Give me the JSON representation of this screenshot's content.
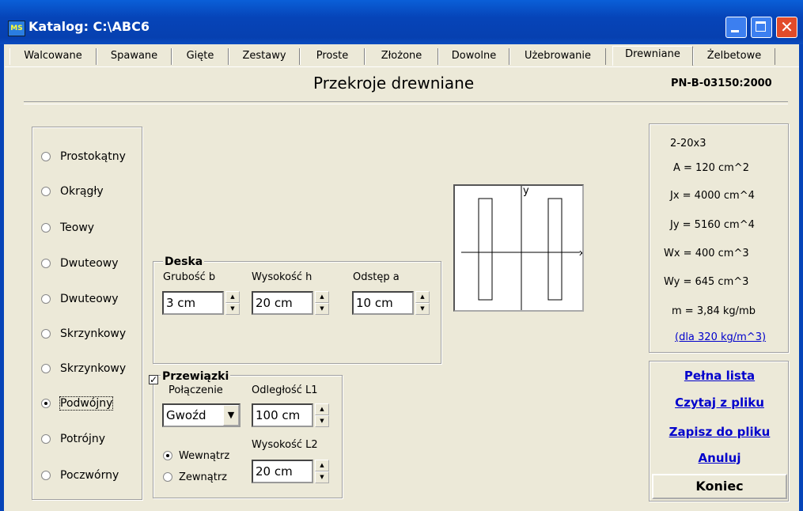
{
  "window": {
    "title": "Katalog: C:\\ABC6",
    "icon_text": "MS"
  },
  "tabs": [
    {
      "label": "Walcowane"
    },
    {
      "label": "Spawane"
    },
    {
      "label": "Gięte"
    },
    {
      "label": "Zestawy"
    },
    {
      "label": "Proste"
    },
    {
      "label": "Złożone"
    },
    {
      "label": "Dowolne"
    },
    {
      "label": "Użebrowanie"
    },
    {
      "label": "Drewniane",
      "active": true
    },
    {
      "label": "Żelbetowe"
    }
  ],
  "header": {
    "title": "Przekroje drewniane",
    "norm": "PN-B-03150:2000"
  },
  "section_types": [
    {
      "label": "Prostokątny",
      "selected": false
    },
    {
      "label": "Okrągły",
      "selected": false
    },
    {
      "label": "Teowy",
      "selected": false
    },
    {
      "label": "Dwuteowy",
      "selected": false
    },
    {
      "label": "Dwuteowy",
      "selected": false
    },
    {
      "label": "Skrzynkowy",
      "selected": false
    },
    {
      "label": "Skrzynkowy",
      "selected": false
    },
    {
      "label": "Podwójny",
      "selected": true
    },
    {
      "label": "Potrójny",
      "selected": false
    },
    {
      "label": "Poczwórny",
      "selected": false
    }
  ],
  "deska": {
    "title": "Deska",
    "grubosc_label": "Grubość b",
    "grubosc_value": "3 cm",
    "wysokosc_label": "Wysokość h",
    "wysokosc_value": "20 cm",
    "odstep_label": "Odstęp a",
    "odstep_value": "10 cm"
  },
  "przewiazki": {
    "title": "Przewiązki",
    "checked": true,
    "check_mark": "✓",
    "polaczenie_label": "Połączenie",
    "polaczenie_value": "Gwoźd",
    "odleglosc_label": "Odległość L1",
    "odleglosc_value": "100 cm",
    "wysokosc_label": "Wysokość L2",
    "wysokosc_value": "20 cm",
    "wewnatrz_label": "Wewnątrz",
    "zewnatrz_label": "Zewnątrz",
    "selected": "Wewnątrz"
  },
  "preview": {
    "axis_y": "y",
    "axis_x": "x"
  },
  "properties": {
    "name": "2-20x3",
    "A": "A = 120 cm^2",
    "Jx": "Jx = 4000 cm^4",
    "Jy": "Jy = 5160 cm^4",
    "Wx": "Wx = 400 cm^3",
    "Wy": "Wy = 645 cm^3",
    "m": "m = 3,84 kg/mb",
    "density_link": "(dla 320 kg/m^3)"
  },
  "actions": {
    "full_list": "Pełna lista",
    "read_file": "Czytaj z pliku",
    "save_file": "Zapisz do pliku",
    "cancel": "Anuluj",
    "end": "Koniec"
  }
}
